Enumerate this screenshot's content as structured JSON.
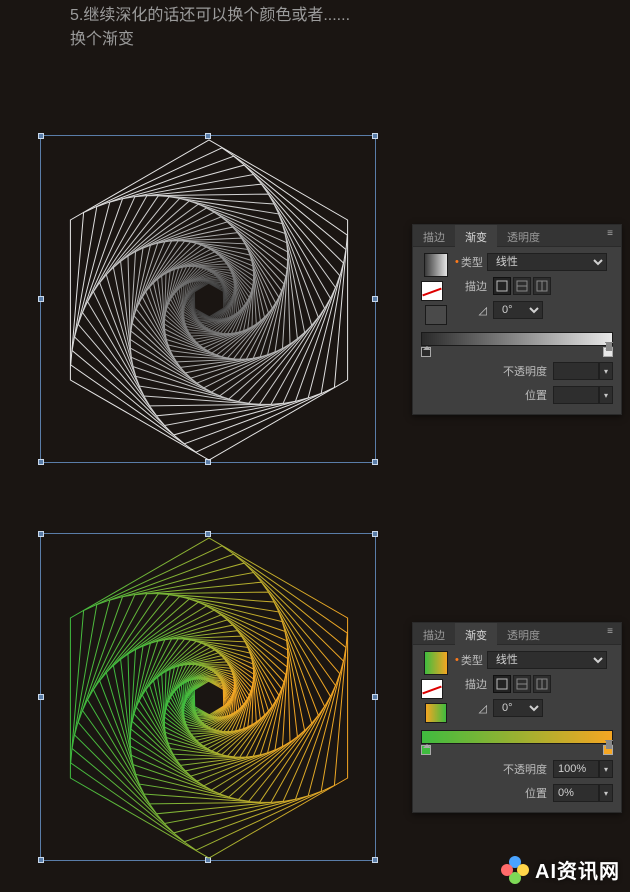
{
  "caption": {
    "line1": "5.继续深化的话还可以换个颜色或者......",
    "line2": "换个渐变"
  },
  "panel1": {
    "tabs": {
      "stroke": "描边",
      "gradient": "渐变",
      "transparency": "透明度"
    },
    "labels": {
      "type": "类型",
      "stroke": "描边",
      "angle": "0°",
      "opacity": "不透明度",
      "position": "位置"
    },
    "type_value": "线性",
    "gradient_colors": [
      "#3b3b3b",
      "#e8e8e8"
    ],
    "stops": [
      {
        "pos": 0,
        "color": "#2a2a2a"
      },
      {
        "pos": 100,
        "color": "#e8e8e8"
      }
    ]
  },
  "panel2": {
    "tabs": {
      "stroke": "描边",
      "gradient": "渐变",
      "transparency": "透明度"
    },
    "labels": {
      "type": "类型",
      "stroke": "描边",
      "angle": "0°",
      "opacity": "不透明度",
      "position": "位置"
    },
    "type_value": "线性",
    "gradient_colors": [
      "#3fbc3f",
      "#f5a623"
    ],
    "stops": [
      {
        "pos": 0,
        "color": "#3fbc3f"
      },
      {
        "pos": 100,
        "color": "#f5a623"
      }
    ],
    "opacity_value": "100%",
    "position_value": "0%"
  },
  "watermark": "AI资讯网"
}
